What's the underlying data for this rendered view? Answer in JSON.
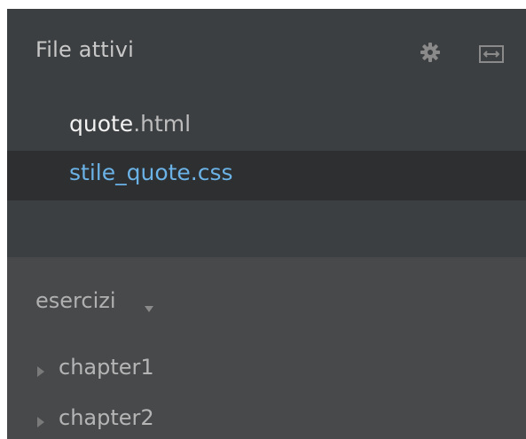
{
  "working_set": {
    "title": "File attivi",
    "files": [
      {
        "name": "quote",
        "ext": ".html",
        "selected": false
      },
      {
        "name": "stile_quote",
        "ext": ".css",
        "selected": true
      }
    ]
  },
  "toolbar": {
    "settings_icon": "gear-icon",
    "split_icon": "split-view-icon"
  },
  "project": {
    "title": "esercizi",
    "folders": [
      {
        "label": "chapter1",
        "expanded": false
      },
      {
        "label": "chapter2",
        "expanded": false
      }
    ]
  },
  "colors": {
    "panel_bg": "#3c3f41",
    "selected_row_bg": "#2d2f31",
    "project_bg": "#47494b",
    "selected_text": "#6bb2e6"
  }
}
